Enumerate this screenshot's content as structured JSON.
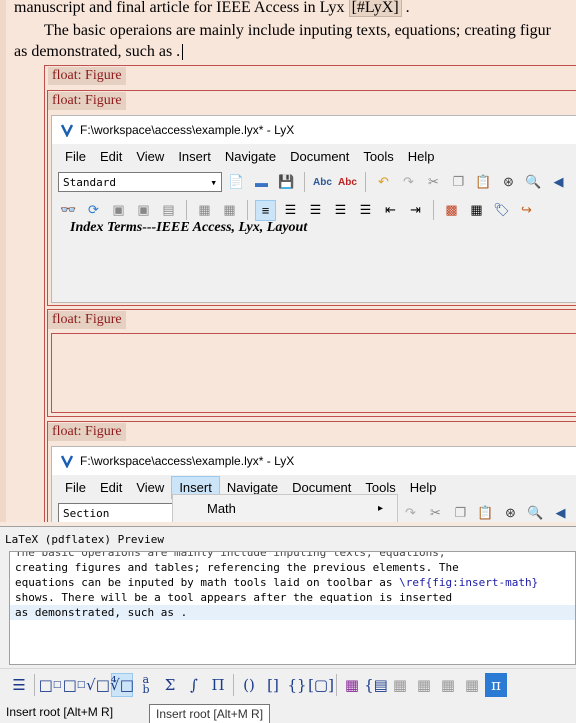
{
  "document": {
    "line1_text": "manuscript and final article for IEEE Access in Lyx",
    "line1_tag": "[#LyX]",
    "line1_end": ".",
    "line2_text": "The basic operaions are mainly include inputing texts, equations; creating figur",
    "line3_text": "as demonstrated, such as ."
  },
  "floats": {
    "outer_label": "float: Figure",
    "inner1_label": "float: Figure",
    "inner2_label": "float: Figure",
    "inner3_label": "float: Figure"
  },
  "lyx_window_1": {
    "title": "F:\\workspace\\access\\example.lyx* - LyX",
    "menus": [
      "File",
      "Edit",
      "View",
      "Insert",
      "Navigate",
      "Document",
      "Tools",
      "Help"
    ],
    "style_select": "Standard",
    "overflow_text": "Index Terms---IEEE Access, Lyx, Layout"
  },
  "lyx_window_2": {
    "title": "F:\\workspace\\access\\example.lyx* - LyX",
    "menus": [
      "File",
      "Edit",
      "View",
      "Insert",
      "Navigate",
      "Document",
      "Tools",
      "Help"
    ],
    "active_menu": "Insert",
    "style_select": "Section",
    "submenu_item": "Math",
    "submenu_arrow": "▸"
  },
  "preview": {
    "title": "LaTeX (pdflatex) Preview",
    "lines": [
      "The basic operaions are mainly include inputing texts, equations;",
      "creating figures and tables; referencing the previous elements. The",
      "equations can be inputed by math tools laid on toolbar as ",
      "shows. There will be a tool appears after the equation is inserted",
      "as demonstrated, such as ."
    ],
    "ref_text": "\\ref{fig:insert-math}"
  },
  "math_toolbar": {
    "icons": [
      "display-math",
      "subscript",
      "superscript",
      "sqrt",
      "root",
      "fraction",
      "sum",
      "integral",
      "product",
      "paren",
      "bracket",
      "brace",
      "matrix-bracket",
      "matrix",
      "cases",
      "table-1",
      "table-2",
      "table-3",
      "table-4",
      "pi"
    ]
  },
  "status": {
    "text": "Insert root [Alt+M R]",
    "tooltip": "Insert root [Alt+M R]"
  }
}
